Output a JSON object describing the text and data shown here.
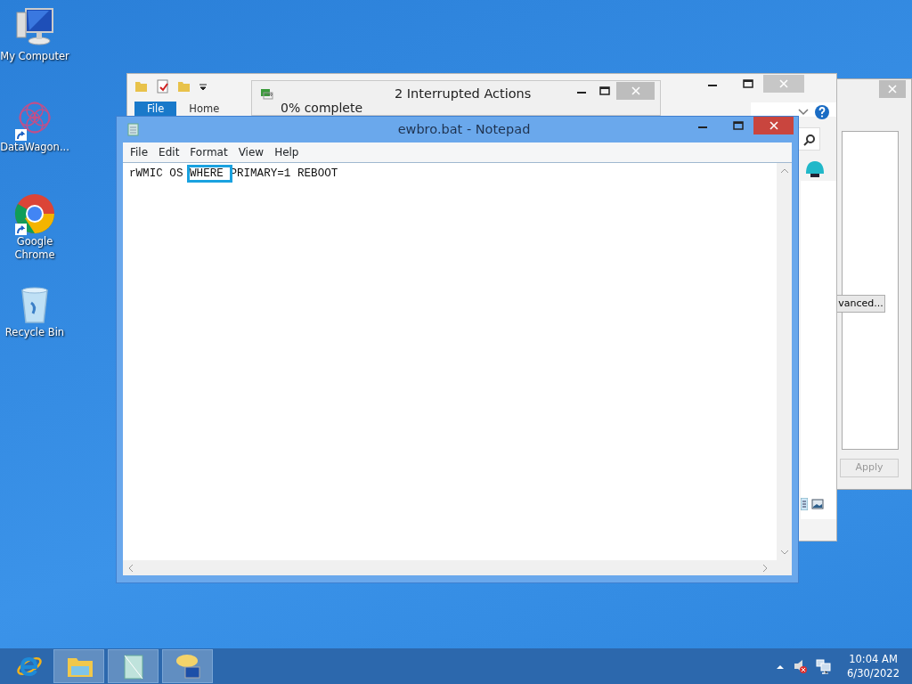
{
  "desktop_icons": [
    {
      "label": "My Computer",
      "shortcut": false
    },
    {
      "label": "DataWagon...",
      "shortcut": true
    },
    {
      "label": "Google Chrome",
      "shortcut": true
    },
    {
      "label": "Recycle Bin",
      "shortcut": false
    }
  ],
  "back_dialog": {
    "advanced_button": "vanced...",
    "apply_button": {
      "label": "Apply",
      "disabled": true
    }
  },
  "explorer": {
    "ribbon_tabs": [
      {
        "label": "File",
        "selected": true
      },
      {
        "label": "Home",
        "selected": false
      }
    ]
  },
  "interrupted_actions": {
    "title": "2 Interrupted Actions",
    "progress_text": "0% complete"
  },
  "notepad": {
    "title": "ewbro.bat - Notepad",
    "menu": [
      "File",
      "Edit",
      "Format",
      "View",
      "Help"
    ],
    "content": [
      {
        "text": "rWMIC OS ",
        "highlighted": false
      },
      {
        "text": "WHERE ",
        "highlighted": true
      },
      {
        "text": "PRIMARY=1 REBOOT",
        "highlighted": false
      }
    ]
  },
  "taskbar": {
    "clock": {
      "time": "10:04 AM",
      "date": "6/30/2022"
    }
  }
}
